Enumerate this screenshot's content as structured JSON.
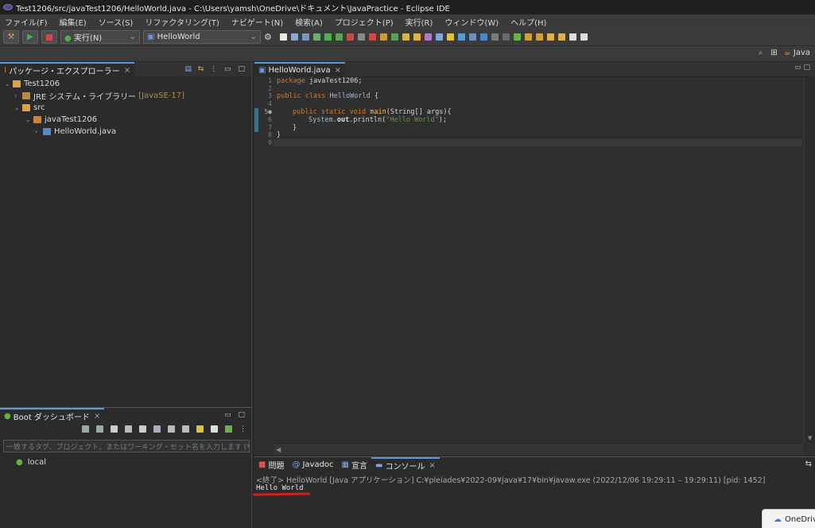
{
  "window": {
    "title": "Test1206/src/javaTest1206/HelloWorld.java - C:\\Users\\yamsh\\OneDrive\\ドキュメント\\JavaPractice - Eclipse IDE"
  },
  "menu": [
    "ファイル(F)",
    "編集(E)",
    "ソース(S)",
    "リファクタリング(T)",
    "ナビゲート(N)",
    "検索(A)",
    "プロジェクト(P)",
    "実行(R)",
    "ウィンドウ(W)",
    "ヘルプ(H)"
  ],
  "toolbar": {
    "run_combo": "実行(N)",
    "config_combo": "HelloWorld"
  },
  "perspective": {
    "label": "Java"
  },
  "package_explorer": {
    "tab_label": "パッケージ・エクスプローラー",
    "close": "×",
    "tree": {
      "project": "Test1206",
      "jre_label": "JRE システム・ライブラリー",
      "jre_version": "[JavaSE-17]",
      "src": "src",
      "package": "javaTest1206",
      "file": "HelloWorld.java"
    }
  },
  "boot_dashboard": {
    "tab_label": "Boot ダッシュボード",
    "close": "×",
    "filter_placeholder": "一致するタグ、プロジェクト、またはワーキング・セット名を入力します (* および ? ワ",
    "local": "local"
  },
  "editor": {
    "tab_label": "HelloWorld.java",
    "close": "×",
    "line_numbers": [
      "1",
      "2",
      "3",
      "4",
      "5●",
      "6",
      "7",
      "8",
      "9"
    ],
    "code": {
      "l1_kw": "package",
      "l1_rest": " javaTest1206;",
      "l3_kw": "public class",
      "l3_cls": " HelloWorld",
      "l3_rest": " {",
      "l5_kw": "public static void",
      "l5_name": " main",
      "l5_rest": "(String[] args){",
      "l6_cls": "System.",
      "l6_out": "out",
      "l6_mid": ".println(",
      "l6_str": "\"Hello World\"",
      "l6_end": ");",
      "l7": "}",
      "l8": "}"
    }
  },
  "console": {
    "tabs": [
      "問題",
      "Javadoc",
      "宣言",
      "コンソール"
    ],
    "close": "×",
    "status": "<終了> HelloWorld [Java アプリケーション] C:¥pleiades¥2022-09¥java¥17¥bin¥javaw.exe  (2022/12/06 19:29:11 – 19:29:11) [pid: 1452]",
    "output": "Hello World"
  },
  "notification": {
    "label": "OneDriv"
  }
}
